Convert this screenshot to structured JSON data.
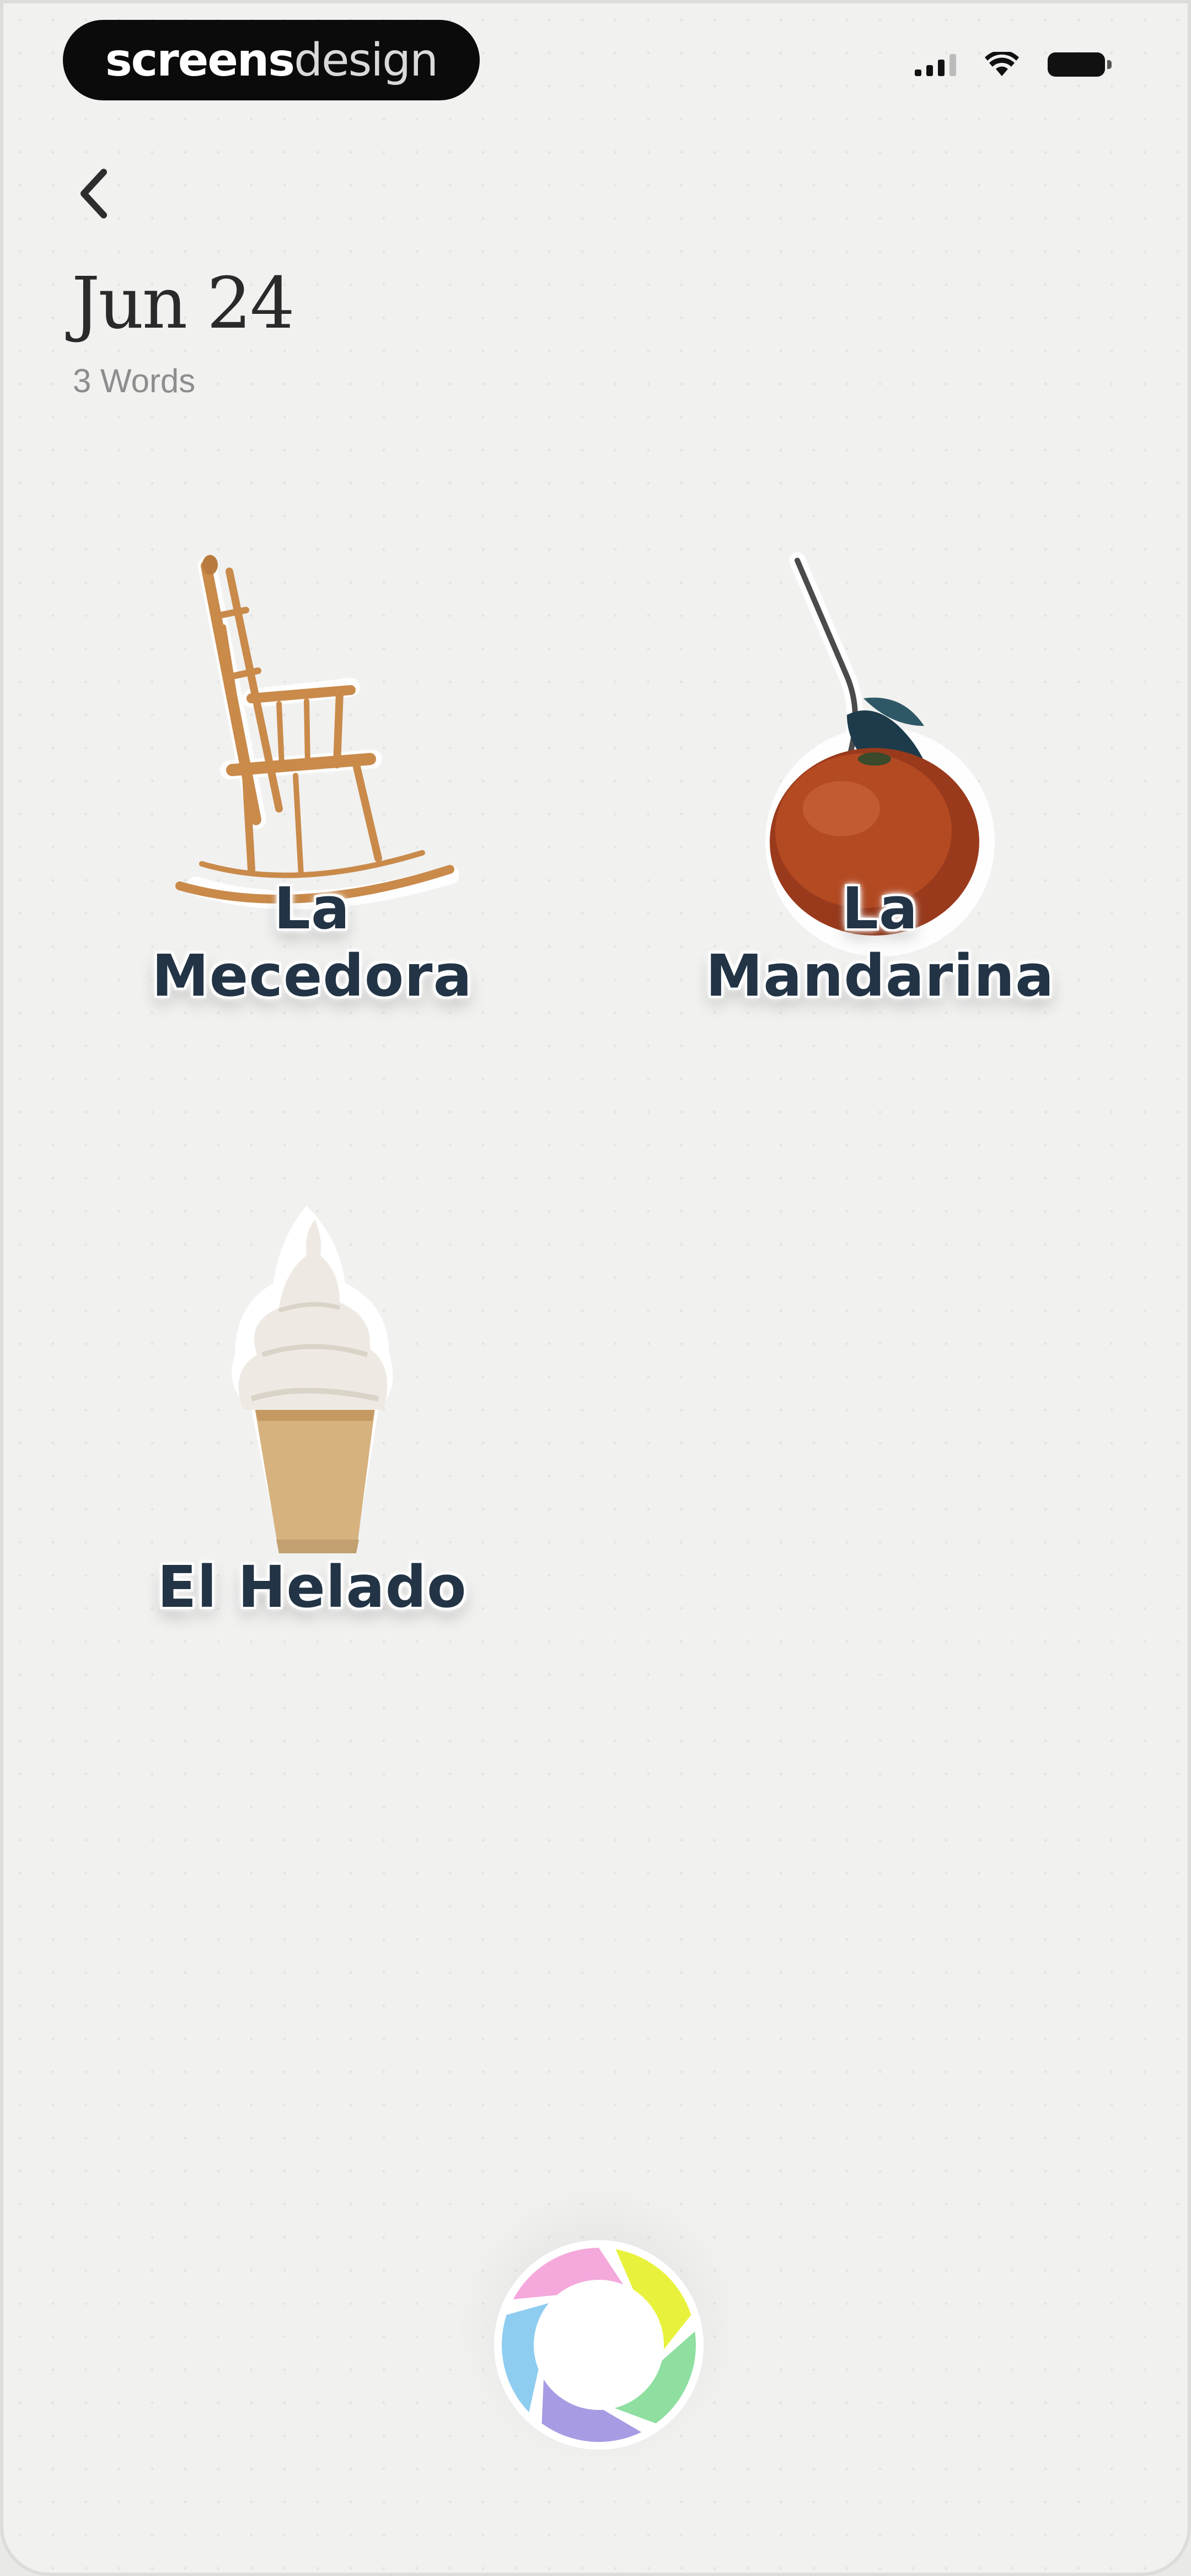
{
  "status_bar": {
    "brand_strong": "screens",
    "brand_light": "design"
  },
  "header": {
    "back_icon": "chevron-left-icon",
    "title": "Jun 24",
    "subtitle": "3 Words"
  },
  "words": [
    {
      "line1": "La",
      "line2": "Mecedora",
      "image": "rocking-chair"
    },
    {
      "line1": "La",
      "line2": "Mandarina",
      "image": "mandarin"
    },
    {
      "line1": "El Helado",
      "line2": "",
      "image": "ice-cream-cone"
    }
  ],
  "capture_button": {
    "icon": "camera-shutter-icon",
    "colors": [
      "#e8f23c",
      "#8edfa0",
      "#a79be4",
      "#8fcdf0",
      "#f4a8dc"
    ]
  }
}
